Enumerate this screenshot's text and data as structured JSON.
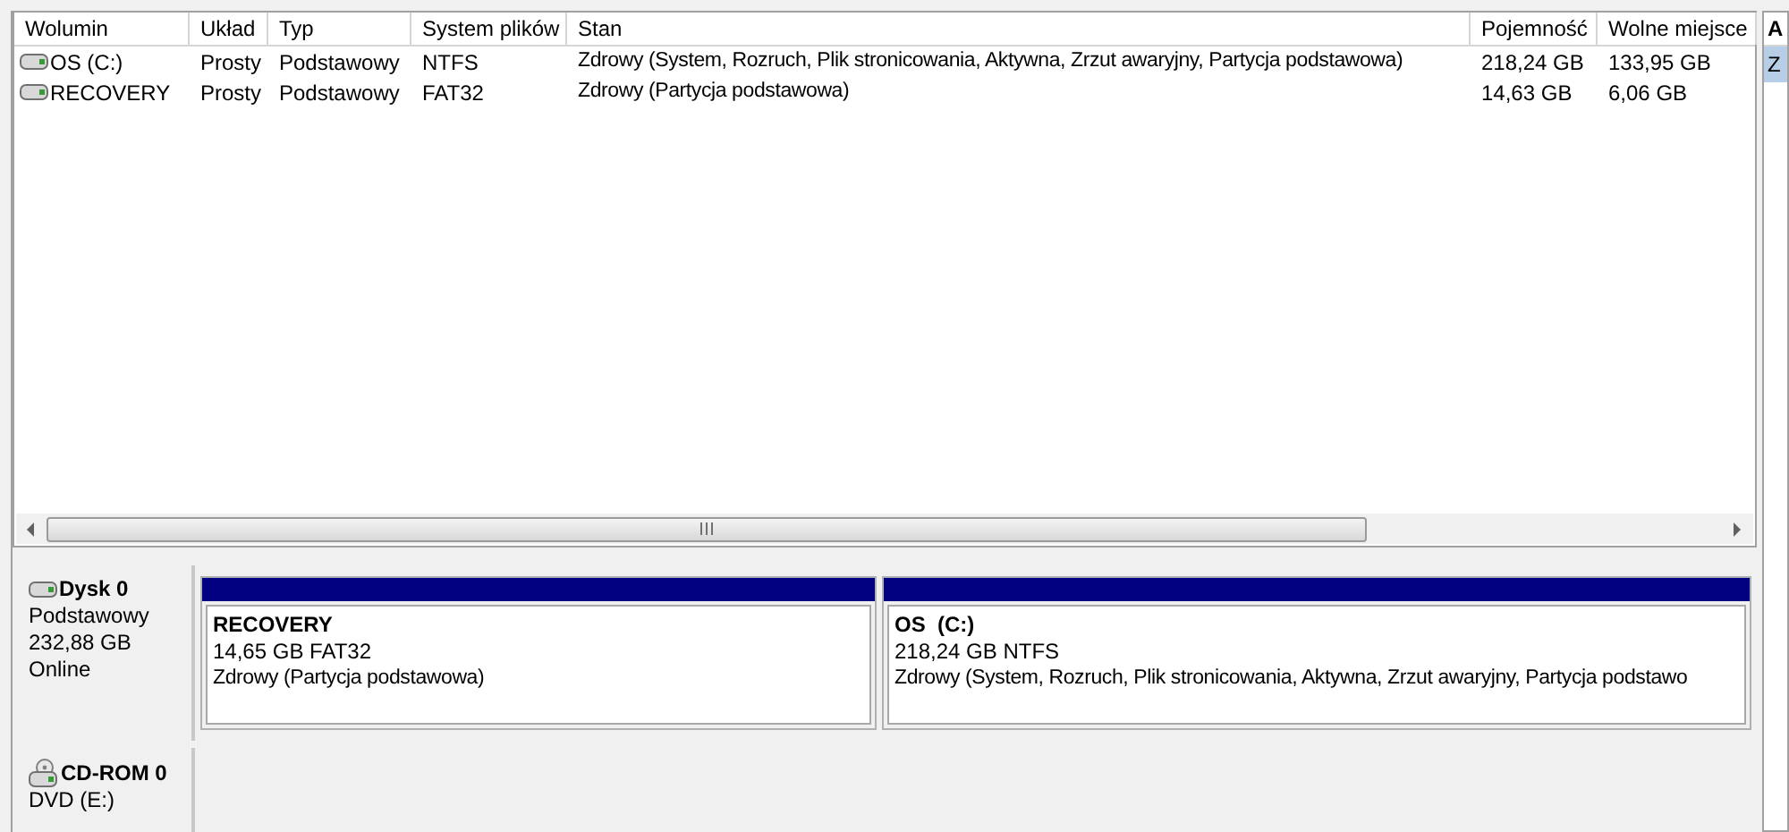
{
  "table": {
    "columns": [
      "Wolumin",
      "Układ",
      "Typ",
      "System plików",
      "Stan",
      "Pojemność",
      "Wolne miejsce"
    ],
    "rows": [
      {
        "cells": [
          "OS (C:)",
          "Prosty",
          "Podstawowy",
          "NTFS",
          "Zdrowy (System, Rozruch, Plik stronicowania, Aktywna, Zrzut awaryjny, Partycja podstawowa)",
          "218,24 GB",
          "133,95 GB"
        ]
      },
      {
        "cells": [
          "RECOVERY",
          "Prosty",
          "Podstawowy",
          "FAT32",
          "Zdrowy (Partycja podstawowa)",
          "14,63 GB",
          "6,06 GB"
        ]
      }
    ]
  },
  "side_panel": {
    "header": "A",
    "items": [
      {
        "label": "Z",
        "selected": true
      }
    ]
  },
  "disks": [
    {
      "kind": "disk",
      "name": "Dysk 0",
      "lines": [
        "Podstawowy",
        "232,88 GB",
        "Online"
      ],
      "partitions": [
        {
          "name": "RECOVERY",
          "size": "14,65 GB FAT32",
          "status": "Zdrowy (Partycja podstawowa)"
        },
        {
          "name": "OS  (C:)",
          "size": "218,24 GB NTFS",
          "status": "Zdrowy (System, Rozruch, Plik stronicowania, Aktywna, Zrzut awaryjny, Partycja podstawo"
        }
      ]
    },
    {
      "kind": "cdrom",
      "name": "CD-ROM 0",
      "lines": [
        "DVD (E:)"
      ]
    }
  ]
}
